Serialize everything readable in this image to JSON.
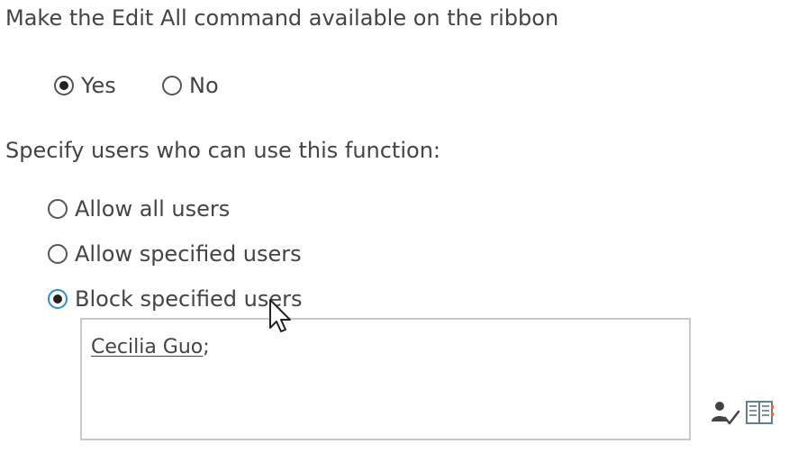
{
  "edit_all_section": {
    "heading": "Make the Edit All command available on the ribbon",
    "options": [
      {
        "label": "Yes",
        "selected": true
      },
      {
        "label": "No",
        "selected": false
      }
    ]
  },
  "users_section": {
    "heading": "Specify users who can use this function:",
    "options": [
      {
        "label": "Allow all users",
        "selected": false
      },
      {
        "label": "Allow specified users",
        "selected": false
      },
      {
        "label": "Block specified users",
        "selected": true
      }
    ]
  },
  "people_picker": {
    "entries": [
      {
        "name": "Cecilia Guo",
        "separator": ";"
      }
    ],
    "check_names_icon": "check-names-icon",
    "browse_icon": "address-book-icon"
  },
  "colors": {
    "text": "#444444",
    "radio_focus": "#2a8dd4",
    "box_border": "#c8c8c8"
  }
}
